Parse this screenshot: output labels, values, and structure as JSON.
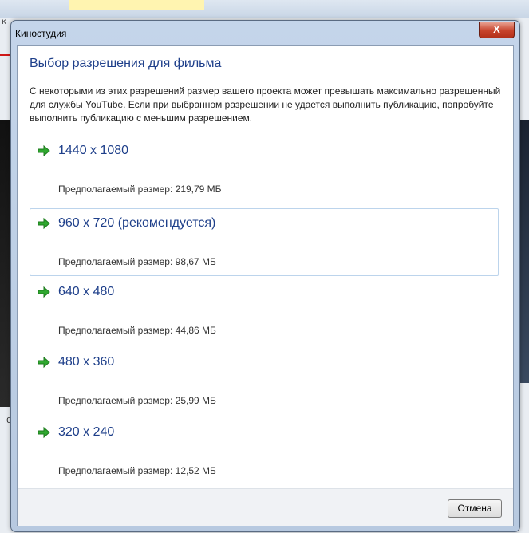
{
  "window": {
    "title": "Киностудия",
    "close_label": "X"
  },
  "dialog": {
    "heading": "Выбор разрешения для фильма",
    "description": "С некоторыми из этих разрешений размер вашего проекта может превышать максимально разрешенный для службы YouTube. Если при выбранном разрешении не удается выполнить публикацию, попробуйте выполнить публикацию с меньшим разрешением.",
    "options": [
      {
        "resolution": "1440 x 1080",
        "size": "Предполагаемый размер: 219,79 МБ"
      },
      {
        "resolution": "960 x 720 (рекомендуется)",
        "size": "Предполагаемый размер: 98,67 МБ"
      },
      {
        "resolution": "640 x 480",
        "size": "Предполагаемый размер: 44,86 МБ"
      },
      {
        "resolution": "480 x 360",
        "size": "Предполагаемый размер: 25,99 МБ"
      },
      {
        "resolution": "320 x 240",
        "size": "Предполагаемый размер: 12,52 МБ"
      }
    ],
    "cancel_label": "Отмена",
    "option_icon": "green-arrow-icon",
    "accent_color": "#1e3f8a"
  },
  "background": {
    "left_label": "к",
    "left_num": "0"
  }
}
